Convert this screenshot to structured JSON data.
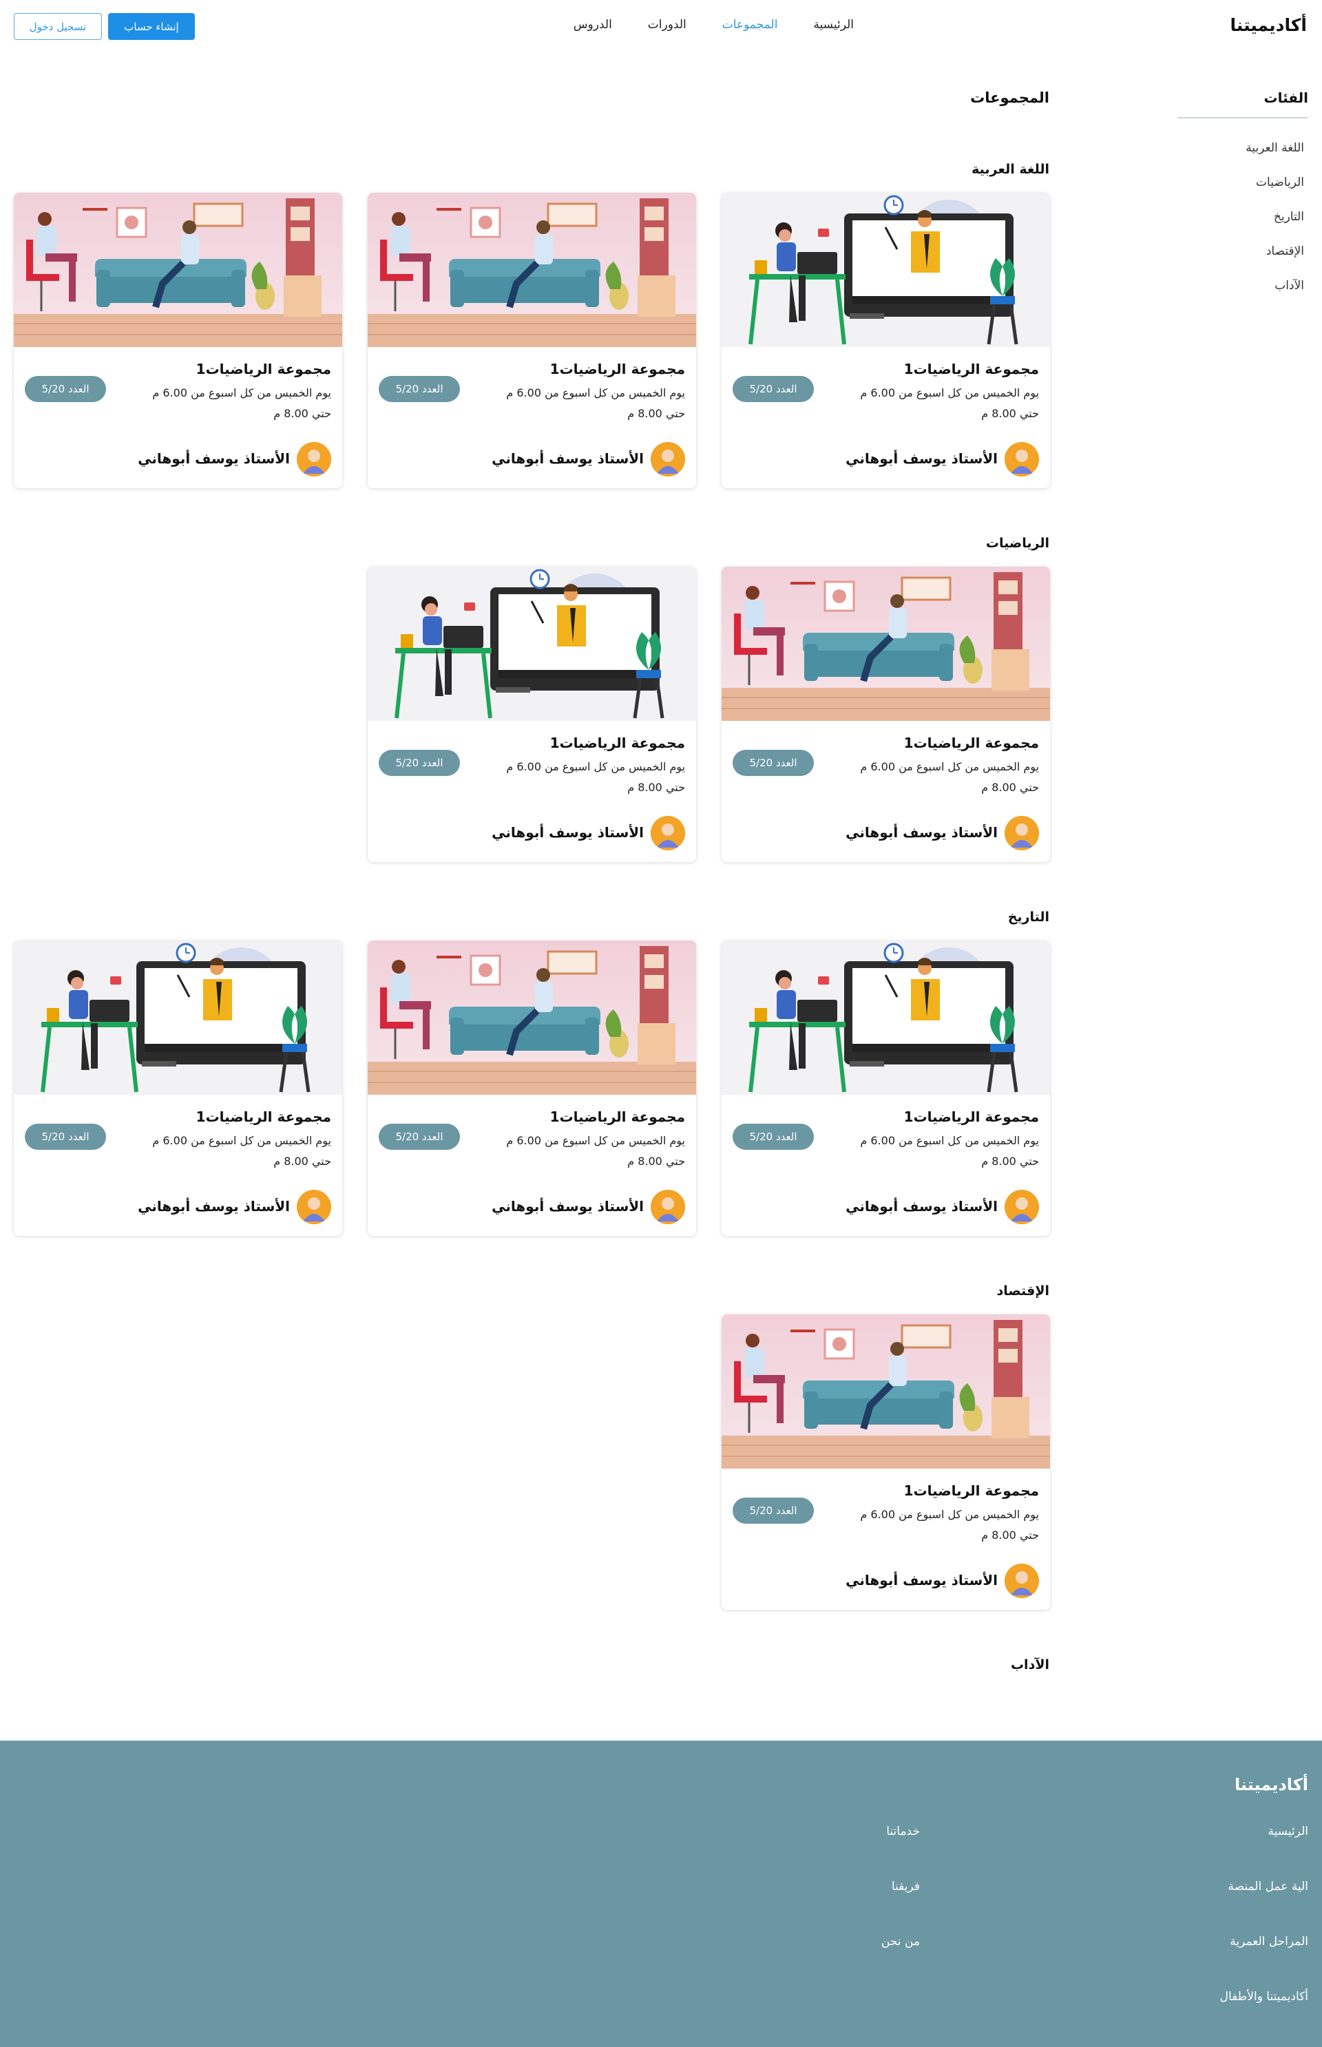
{
  "header": {
    "brand": "أكاديميتنا",
    "nav": [
      {
        "label": "الرئيسية",
        "active": false
      },
      {
        "label": "المجموعات",
        "active": true
      },
      {
        "label": "الدورات",
        "active": false
      },
      {
        "label": "الدروس",
        "active": false
      }
    ],
    "signup_label": "إنشاء حساب",
    "login_label": "تسجيل دخول"
  },
  "sidebar": {
    "title": "الفئات",
    "items": [
      "اللغة العربية",
      "الرياضيات",
      "التاريخ",
      "الإقتصاد",
      "الآداب"
    ]
  },
  "main": {
    "title": "المجموعات",
    "sections": [
      {
        "title": "اللغة العربية",
        "cards": [
          {
            "image": "online-class",
            "title": "مجموعة الرياضيات1",
            "schedule": "يوم الخميس من كل اسبوع من 6.00 م حتي 8.00 م",
            "count": "العدد 5/20",
            "teacher": "الأستاذ يوسف أبوهاني"
          },
          {
            "image": "living-room",
            "title": "مجموعة الرياضيات1",
            "schedule": "يوم الخميس من كل اسبوع من 6.00 م حتي 8.00 م",
            "count": "العدد 5/20",
            "teacher": "الأستاذ يوسف أبوهاني"
          },
          {
            "image": "living-room",
            "title": "مجموعة الرياضيات1",
            "schedule": "يوم الخميس من كل اسبوع من 6.00 م حتي 8.00 م",
            "count": "العدد 5/20",
            "teacher": "الأستاذ يوسف أبوهاني"
          }
        ]
      },
      {
        "title": "الرياضيات",
        "cards": [
          {
            "image": "living-room",
            "title": "مجموعة الرياضيات1",
            "schedule": "يوم الخميس من كل اسبوع من 6.00 م حتي 8.00 م",
            "count": "العدد 5/20",
            "teacher": "الأستاذ يوسف أبوهاني"
          },
          {
            "image": "online-class",
            "title": "مجموعة الرياضيات1",
            "schedule": "يوم الخميس من كل اسبوع من 6.00 م حتي 8.00 م",
            "count": "العدد 5/20",
            "teacher": "الأستاذ يوسف أبوهاني"
          }
        ]
      },
      {
        "title": "التاريخ",
        "cards": [
          {
            "image": "online-class",
            "title": "مجموعة الرياضيات1",
            "schedule": "يوم الخميس من كل اسبوع من 6.00 م حتي 8.00 م",
            "count": "العدد 5/20",
            "teacher": "الأستاذ يوسف أبوهاني"
          },
          {
            "image": "living-room",
            "title": "مجموعة الرياضيات1",
            "schedule": "يوم الخميس من كل اسبوع من 6.00 م حتي 8.00 م",
            "count": "العدد 5/20",
            "teacher": "الأستاذ يوسف أبوهاني"
          },
          {
            "image": "online-class",
            "title": "مجموعة الرياضيات1",
            "schedule": "يوم الخميس من كل اسبوع من 6.00 م حتي 8.00 م",
            "count": "العدد 5/20",
            "teacher": "الأستاذ يوسف أبوهاني"
          }
        ]
      },
      {
        "title": "الإقتصاد",
        "cards": [
          {
            "image": "living-room",
            "title": "مجموعة الرياضيات1",
            "schedule": "يوم الخميس من كل اسبوع من 6.00 م حتي 8.00 م",
            "count": "العدد 5/20",
            "teacher": "الأستاذ يوسف أبوهاني"
          }
        ]
      },
      {
        "title": "الآداب",
        "cards": []
      }
    ]
  },
  "footer": {
    "brand": "أكاديميتنا",
    "right_links": [
      "الرئيسية",
      "الية عمل المنصة",
      "المراحل العمرية",
      "أكاديميتنا والأطفال"
    ],
    "left_links": [
      "خدماتنا",
      "فريقنا",
      "من نحن"
    ]
  },
  "colors": {
    "accent": "#1e8fe6",
    "badge": "#6b97a3",
    "footer": "#6b97a3"
  }
}
